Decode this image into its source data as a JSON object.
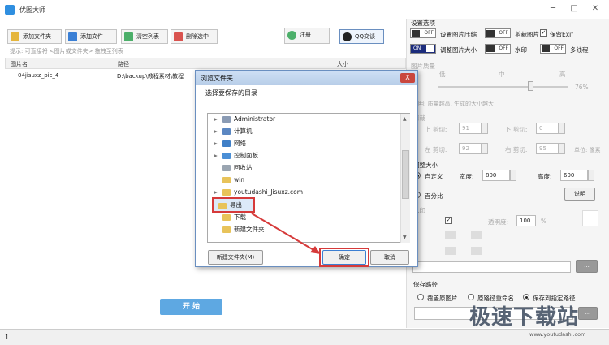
{
  "app": {
    "title": "优图大师"
  },
  "toolbar": {
    "add_folder": "添加文件夹",
    "add_file": "添加文件",
    "clear_list": "清空列表",
    "delete_selected": "删除选中",
    "register": "注册",
    "qq": "QQ交谈"
  },
  "hint": "提示: 可直接将 <图片或文件夹> 拖拽至列表",
  "grid": {
    "columns": [
      "图片名",
      "路径",
      "大小"
    ],
    "rows": [
      {
        "name": "04jisuxz_pic_4",
        "path": "D:\\backup\\教程素材\\教程"
      }
    ]
  },
  "start_label": "开 始",
  "status": {
    "count": "1"
  },
  "settings": {
    "section_title": "设置选项",
    "toggles": [
      {
        "state": "OFF",
        "label": "设置图片压缩"
      },
      {
        "state": "OFF",
        "label": "剪裁图片"
      },
      {
        "label": "保留Exif"
      },
      {
        "state": "ON",
        "label": "调整图片大小"
      },
      {
        "state": "OFF",
        "label": "水印"
      },
      {
        "state": "OFF",
        "label": "多线程"
      }
    ],
    "quality": {
      "title": "图片质量",
      "low": "低",
      "mid": "中",
      "high": "高",
      "percent": "76%",
      "note": "说明: 质量越高, 生成的大小越大"
    },
    "crop": {
      "title": "剪裁",
      "top_label": "上 剪切:",
      "top": "91",
      "bottom_label": "下 剪切:",
      "bottom": "0",
      "left_label": "左 剪切:",
      "left": "92",
      "right_label": "右 剪切:",
      "right": "95",
      "unit": "单位: 像素"
    },
    "resize": {
      "title": "调整大小",
      "custom": "自定义",
      "width_label": "宽度:",
      "width": "800",
      "height_label": "高度:",
      "height": "600",
      "percent": "百分比",
      "help": "说明"
    },
    "watermark": {
      "title": "水印",
      "opacity_label": "透明度:",
      "opacity": "100",
      "pct": "%",
      "browse": "..."
    },
    "save": {
      "title": "保存路径",
      "options": [
        "覆盖原图片",
        "原路径重命名",
        "保存到指定路径"
      ],
      "browse": "..."
    }
  },
  "dialog": {
    "title": "浏览文件夹",
    "close": "X",
    "subtitle": "选择要保存的目录",
    "tree": [
      "Administrator",
      "计算机",
      "网络",
      "控制面板",
      "回收站",
      "win",
      "youtudashi_Jisuxz.com",
      "导出",
      "下载",
      "新建文件夹"
    ],
    "new_folder": "新建文件夹(M)",
    "ok": "确定",
    "cancel": "取消"
  },
  "watermark_brand": {
    "text": "极速下载站",
    "url": "www.youtudashi.com"
  },
  "colors": {
    "accent": "#1c2c7c",
    "start": "#5ea8e2",
    "annotation": "#d63a3a"
  }
}
